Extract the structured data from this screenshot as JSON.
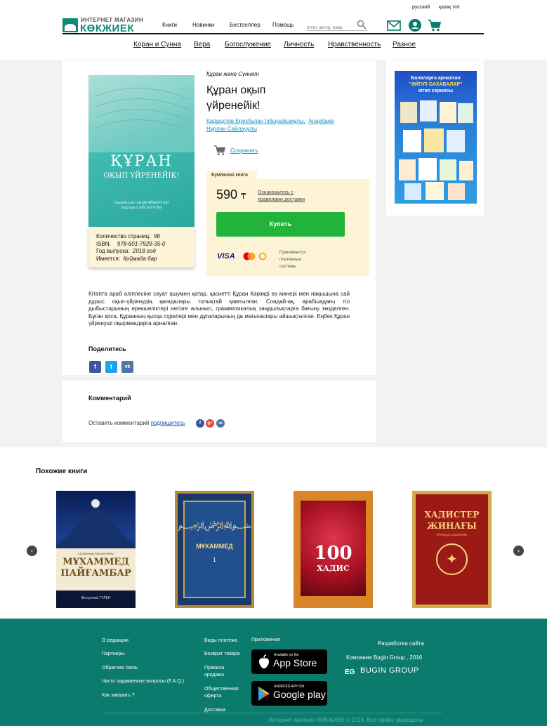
{
  "header": {
    "lang_ru": "русский",
    "lang_kz": "қазақ тілі",
    "logo_top": "ИНТЕРНЕТ МАГАЗИН",
    "logo_main": "КӨКЖИЕК",
    "nav": [
      "Книги",
      "Новинки",
      "Бестселлер",
      "Помощь"
    ],
    "search_placeholder": "Кітап, автор, жанр",
    "categories": [
      "Коран и Сунна",
      "Вера",
      "Богослужение",
      "Личность",
      "Нравственность",
      "Разное"
    ]
  },
  "product": {
    "category": "Құран және Сүннет",
    "title_line1": "Құран оқып",
    "title_line2": "үйренейік!",
    "author1": "Қарақұлов Ерекбұлан Ізбырайымұлы,",
    "author2": "Анарбаев",
    "author3": "Нұрлан Сайлауұлы",
    "save_label": "Сохранить",
    "format_tab": "Бумажная книга",
    "price": "590",
    "currency": "₸",
    "delivery_rules_1": "Ознакомьтесь с",
    "delivery_rules_2": "правилами доставки",
    "buy_label": "Купить",
    "payment_note_1": "Принимается",
    "payment_note_2": "платежные",
    "payment_note_3": "системы",
    "visa": "VISA",
    "cover_title_1": "ҚҰРАН",
    "cover_title_2": "ОҚЫП ҮЙРЕНЕЙІК!",
    "cover_authors_1": "Ерекбұлан ІЗБЫРАЙЫМҰЛЫ",
    "cover_authors_2": "Нұрлан САЙЛАУҰЛЫ",
    "details": {
      "pages_label": "Количество страниц:",
      "pages": "96",
      "isbn_label": "ISBN:",
      "isbn": "978-601-7929-35-0",
      "year_label": "Год выпуска:",
      "year": "2018 год",
      "stock_label": "Имеется:",
      "stock": "Қоймада бар"
    },
    "description": "Кітапта араб әліппесіне сауат ашумен қатар, қасиетті Құран Кәрімді өз мәнері мен нақышына сай дұрыс оқып-үйренудің қағидалары толықтай қамтылған. Сондай-ақ, арабшадағы тіл дыбыстарының ерекшеліктері негізге алынып, грамматикалық заңдылықтарға бағыну көзделген. Бұған қоса, Құранның қысқа сүрелері мен дұғаларының да мағыналары айшықталған. Еңбек Құран үйренуші оқырмандарға арналған."
  },
  "share": {
    "title": "Поделитесь",
    "fb": "f",
    "tw": "t",
    "vk": "vk"
  },
  "comments": {
    "title": "Комментарий",
    "prompt": "Оставить комментарий",
    "subscribe": "подпишитесь",
    "fb": "f",
    "gp": "g+",
    "vk": "vk"
  },
  "banner": {
    "line1": "Балаларға арналған",
    "line2": "\"ӘЙГІЛІ САХАБАЛАР\"",
    "line3": "кітап сериясы"
  },
  "similar": {
    "title": "Похожие книги",
    "prev": "‹",
    "next": "›",
    "books": [
      {
        "t1": "ҒАЛАМНЫҢ РАҚЫМ НҰРЫ",
        "t2": "МҰХАММЕД",
        "t3": "ПАЙҒАМБАР",
        "author": "Фетхуллаһ ГҮЛЕН"
      },
      {
        "t1": "МҰХАММЕД",
        "t2": "1"
      },
      {
        "t1": "100",
        "t2": "ХАДИС"
      },
      {
        "t1": "ХАДИСТЕР",
        "t2": "ЖИНАҒЫ",
        "t3": "(РИЯАДУС-САЛИХИН)"
      }
    ]
  },
  "footer": {
    "col1": [
      "О редакции",
      "Партнеры",
      "Обратная связь",
      "Часто задаваемые вопросы (F.A.Q.)",
      "Как заказать ?"
    ],
    "col2": [
      "Виды платежа",
      "Возврат товара",
      "Правила продажа",
      "Общественная оферта",
      "Доставка"
    ],
    "apps_title": "Приложения",
    "appstore_small": "Available on the",
    "appstore_big": "App Store",
    "gplay_small": "ANDROID APP ON",
    "gplay_big": "Google play",
    "dev_title": "Разработка сайта",
    "dev_company": "Компания Bugin Group , 2016",
    "dev_logo": "BUGIN GROUP",
    "copyright": "Интернет-магазин КӨКЖИЕК  © 2016. Все права защищены"
  },
  "colors": {
    "brand": "#0a7b6c",
    "buy": "#22b33a",
    "link": "#1a8fc0"
  }
}
